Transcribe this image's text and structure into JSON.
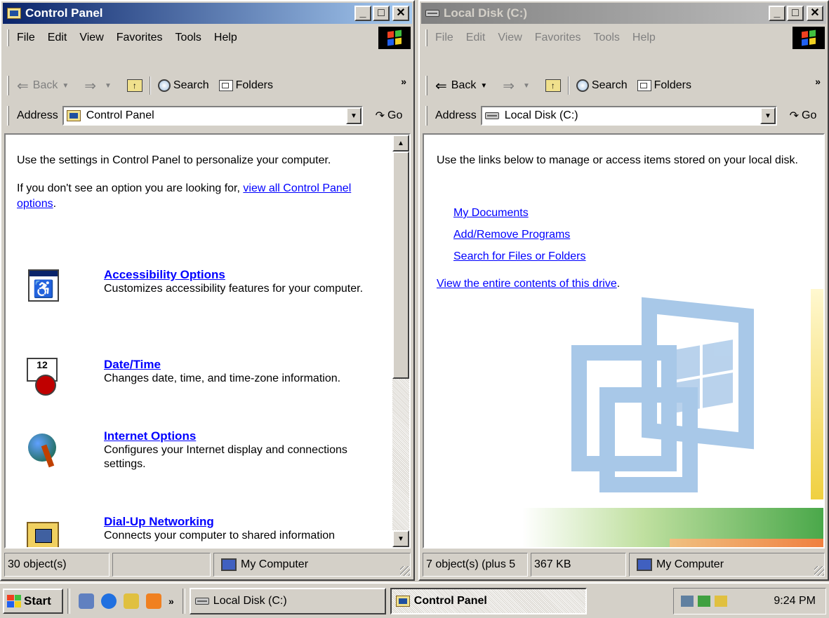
{
  "left": {
    "title": "Control Panel",
    "menu": [
      "File",
      "Edit",
      "View",
      "Favorites",
      "Tools",
      "Help"
    ],
    "toolbar": {
      "back": "Back",
      "search": "Search",
      "folders": "Folders",
      "more": "»"
    },
    "address": {
      "label": "Address",
      "value": "Control Panel",
      "go": "Go"
    },
    "intro1": "Use the settings in Control Panel to personalize your computer.",
    "intro2_prefix": "If you don't see an option you are looking for, ",
    "intro2_link": "view all Control Panel options",
    "intro2_suffix": ".",
    "items": [
      {
        "name": "Accessibility Options",
        "desc": "Customizes accessibility features for your computer."
      },
      {
        "name": "Date/Time",
        "desc": "Changes date, time, and time-zone information."
      },
      {
        "name": "Internet Options",
        "desc": "Configures your Internet display and connections settings."
      },
      {
        "name": "Dial-Up Networking",
        "desc": "Connects your computer to shared information"
      }
    ],
    "status": {
      "objects": "30 object(s)",
      "location": "My Computer"
    }
  },
  "right": {
    "title": "Local Disk (C:)",
    "menu": [
      "File",
      "Edit",
      "View",
      "Favorites",
      "Tools",
      "Help"
    ],
    "toolbar": {
      "back": "Back",
      "search": "Search",
      "folders": "Folders",
      "more": "»"
    },
    "address": {
      "label": "Address",
      "value": "Local Disk (C:)",
      "go": "Go"
    },
    "intro": "Use the links below to manage or access items stored on your local disk.",
    "links": [
      "My Documents",
      "Add/Remove Programs",
      "Search for Files or Folders"
    ],
    "view_link": "View the entire contents of this drive",
    "view_suffix": ".",
    "status": {
      "objects": "7 object(s) (plus 5",
      "size": "367 KB",
      "location": "My Computer"
    }
  },
  "taskbar": {
    "start": "Start",
    "more": "»",
    "tasks": [
      "Local Disk (C:)",
      "Control Panel"
    ],
    "clock": "9:24 PM"
  },
  "colors": {
    "title_active": "#0a246a",
    "title_inactive": "#808080",
    "link": "#0000ff",
    "face": "#d4d0c8"
  }
}
